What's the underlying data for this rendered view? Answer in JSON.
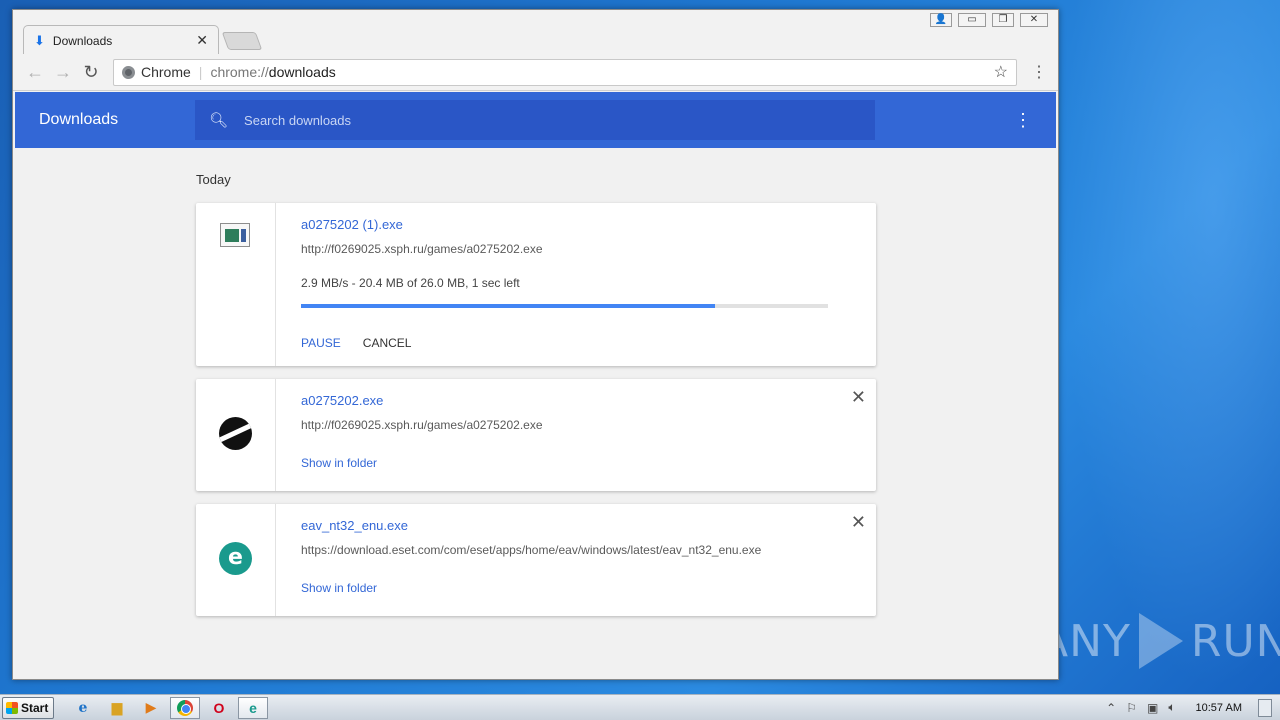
{
  "tab": {
    "title": "Downloads",
    "close": "✕"
  },
  "window_controls": {
    "user": "👤",
    "minimize": "▭",
    "maximize": "❐",
    "close": "✕"
  },
  "omnibox": {
    "site_name": "Chrome",
    "url_scheme": "chrome://",
    "url_host": "downloads"
  },
  "page": {
    "title": "Downloads",
    "search_placeholder": "Search downloads",
    "section_label": "Today"
  },
  "downloads": [
    {
      "filename": "a0275202 (1).exe",
      "url": "http://f0269025.xsph.ru/games/a0275202.exe",
      "status": "2.9 MB/s - 20.4 MB of 26.0 MB, 1 sec left",
      "progress": 0.785,
      "pause_label": "PAUSE",
      "cancel_label": "CANCEL",
      "icon": "exe-file-icon"
    },
    {
      "filename": "a0275202.exe",
      "url": "http://f0269025.xsph.ru/games/a0275202.exe",
      "show_in_folder": "Show in folder",
      "icon": "app-s-icon"
    },
    {
      "filename": "eav_nt32_enu.exe",
      "url": "https://download.eset.com/com/eset/apps/home/eav/windows/latest/eav_nt32_enu.exe",
      "show_in_folder": "Show in folder",
      "icon": "eset-icon"
    }
  ],
  "taskbar": {
    "start_label": "Start",
    "clock": "10:57 AM"
  },
  "watermark": {
    "left": "ANY",
    "right": "RUN"
  },
  "colors": {
    "header": "#3367d6",
    "search": "#2a56c6",
    "link": "#3367d6",
    "progress": "#4285f4"
  }
}
